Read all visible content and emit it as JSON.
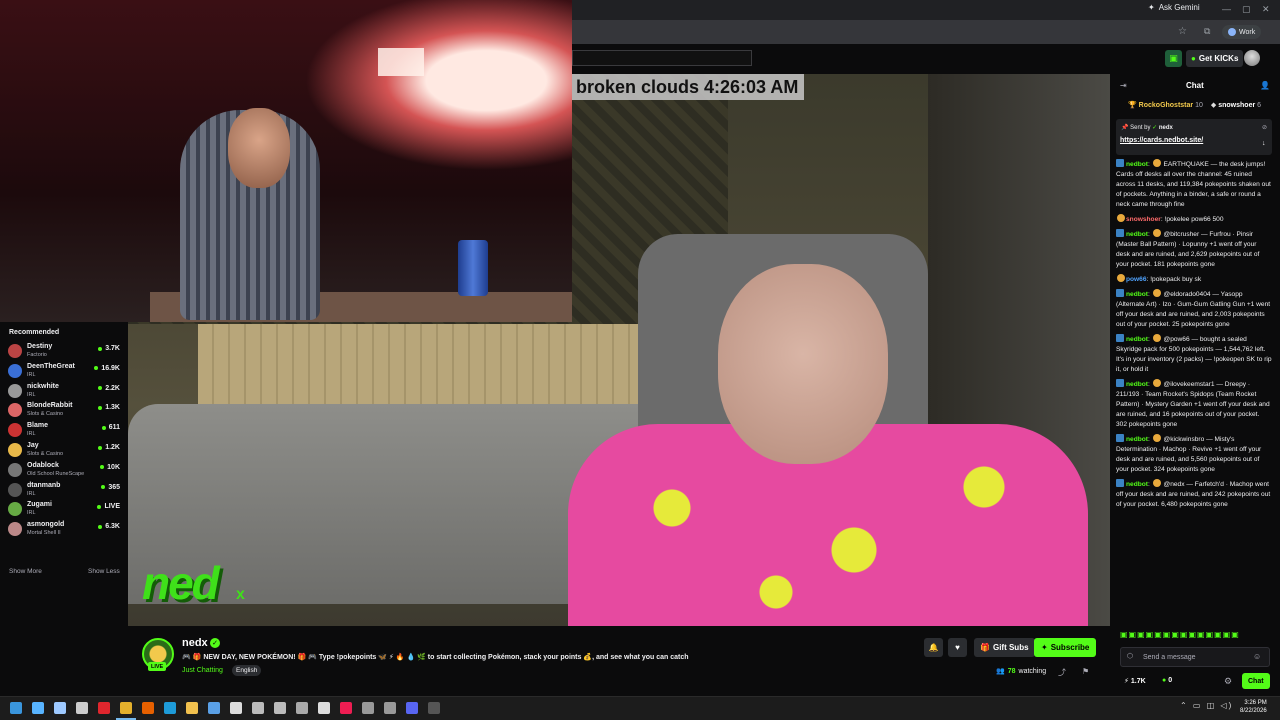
{
  "browser": {
    "ask_gemini": "Ask Gemini",
    "profile_label": "Work"
  },
  "header": {
    "get_kicks": "Get KICKs"
  },
  "overlay": {
    "weather_time": "broken clouds 4:26:03 AM",
    "logo_text": "ned",
    "logo_x": "x"
  },
  "sidebar": {
    "title": "Recommended",
    "items": [
      {
        "name": "Destiny",
        "category": "Factorio",
        "viewers": "3.7K",
        "color": "#b44"
      },
      {
        "name": "DeenTheGreat",
        "category": "IRL",
        "viewers": "16.9K",
        "color": "#3a6fd6"
      },
      {
        "name": "nickwhite",
        "category": "IRL",
        "viewers": "2.2K",
        "color": "#999"
      },
      {
        "name": "BlondeRabbit",
        "category": "Slots & Casino",
        "viewers": "1.3K",
        "color": "#d66"
      },
      {
        "name": "Blame",
        "category": "IRL",
        "viewers": "611",
        "color": "#c33"
      },
      {
        "name": "Jay",
        "category": "Slots & Casino",
        "viewers": "1.2K",
        "color": "#e9b949"
      },
      {
        "name": "Odablock",
        "category": "Old School RuneScape",
        "viewers": "10K",
        "color": "#777"
      },
      {
        "name": "dtanmanb",
        "category": "IRL",
        "viewers": "365",
        "color": "#555"
      },
      {
        "name": "Zugami",
        "category": "IRL",
        "viewers": "LIVE",
        "color": "#6a4"
      },
      {
        "name": "asmongold",
        "category": "Mortal Shell II",
        "viewers": "6.3K",
        "color": "#b88"
      }
    ],
    "show_more": "Show More",
    "show_less": "Show Less"
  },
  "stream": {
    "streamer": "nedx",
    "live": "LIVE",
    "title": "🎮 🎁 NEW DAY, NEW POKÉMON! 🎁 🎮 Type !pokepoints 🦋 ⚡ 🔥 💧 🌿 to start collecting Pokémon, stack your points 💰, and see what you can catch",
    "category": "Just Chatting",
    "language": "English",
    "gift_subs": "Gift Subs",
    "subscribe": "Subscribe",
    "watching_count": "78",
    "watching_label": "watching"
  },
  "chat": {
    "title": "Chat",
    "leaderboard": [
      {
        "name": "RockoGhoststar",
        "count": "10"
      },
      {
        "name": "snowshoer",
        "count": "6"
      }
    ],
    "pinned": {
      "sent_by": "Sent by",
      "user": "nedx",
      "link": "https://cards.nedbot.site/"
    },
    "messages": [
      {
        "user": "nedbot",
        "color": "#53fc18",
        "text": "EARTHQUAKE — the desk jumps! Cards off desks all over the channel: 45 ruined across 11 desks, and 119,384 pokepoints shaken out of pockets. Anything in a binder, a safe or round a neck came through fine"
      },
      {
        "user": "snowshoer",
        "color": "#ff6b6b",
        "text": "!pokelee pow66 500"
      },
      {
        "user": "nedbot",
        "color": "#53fc18",
        "text": "@bitcrusher — Furfrou · Pinsir (Master Ball Pattern) · Lopunny +1 went off your desk and are ruined, and 2,629 pokepoints out of your pocket. 181 pokepoints gone"
      },
      {
        "user": "pow66",
        "color": "#4fa3ff",
        "text": "!pokepack buy sk"
      },
      {
        "user": "nedbot",
        "color": "#53fc18",
        "text": "@eldorado0404 — Yasopp (Alternate Art) · Izo · Gum-Gum Gatling Gun +1 went off your desk and are ruined, and 2,003 pokepoints out of your pocket. 25 pokepoints gone"
      },
      {
        "user": "nedbot",
        "color": "#53fc18",
        "text": "@pow66 — bought a sealed Skyridge pack for 500 pokepoints — 1,544,762 left. It's in your inventory (2 packs) — !pokeopen SK to rip it, or hold it"
      },
      {
        "user": "nedbot",
        "color": "#53fc18",
        "text": "@ilovekeemstar1 — Dreepy · 211/193 · Team Rocket's Spidops (Team Rocket Pattern) · Mystery Garden +1 went off your desk and are ruined, and 16 pokepoints out of your pocket. 302 pokepoints gone"
      },
      {
        "user": "nedbot",
        "color": "#53fc18",
        "text": "@kickwinsbro — Misty's Determination · Machop · Revive +1 went off your desk and are ruined, and 5,560 pokepoints out of your pocket. 324 pokepoints gone"
      },
      {
        "user": "nedbot",
        "color": "#53fc18",
        "text": "@nedx — Farfetch'd · Machop went off your desk and are ruined, and 242 pokepoints out of your pocket. 6,480 pokepoints gone"
      }
    ],
    "input_placeholder": "Send a message",
    "kicks": "1.7K",
    "points": "0",
    "chat_button": "Chat"
  },
  "taskbar": {
    "time": "3:26 PM",
    "date": "8/22/2026"
  }
}
